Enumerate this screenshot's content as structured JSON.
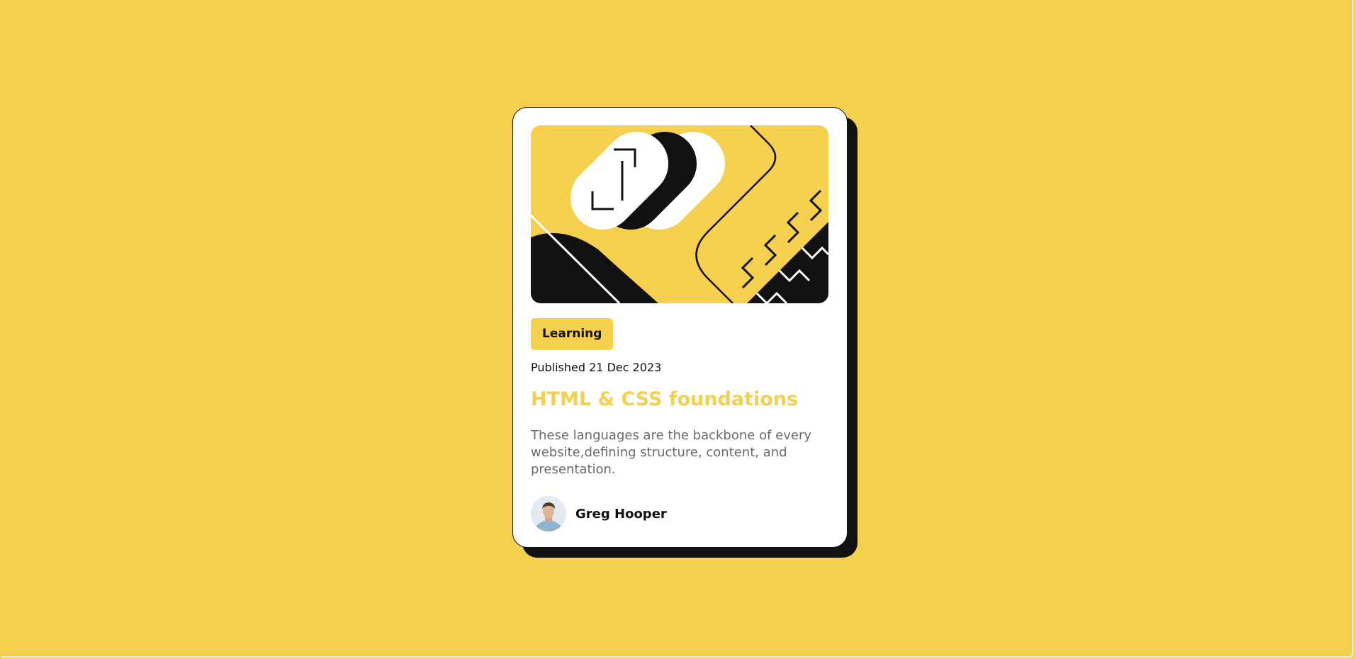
{
  "colors": {
    "background": "#f4d04e",
    "card": "#ffffff",
    "ink": "#111111",
    "accent": "#f4d04e",
    "muted_text": "#6b6b6b"
  },
  "card": {
    "image_icon": "code-illustration",
    "tag": "Learning",
    "published": "Published 21 Dec 2023",
    "title": "HTML & CSS foundations",
    "description": "These languages are the backbone of every website,defining structure, content, and presentation.",
    "author": {
      "avatar_icon": "author-avatar",
      "name": "Greg Hooper"
    }
  }
}
